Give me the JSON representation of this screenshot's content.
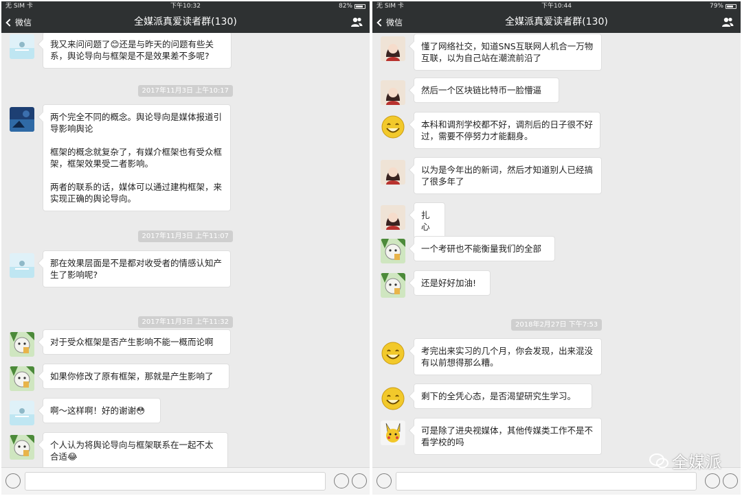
{
  "colors": {
    "navbar": "#2e3132",
    "chat_background": "#ebebeb",
    "bubble": "#ffffff",
    "time_pill": "#cfcfcf"
  },
  "left": {
    "status": {
      "carrier": "无 SIM 卡",
      "time": "下午10:32",
      "battery": "82%",
      "battery_level": 0.82
    },
    "nav": {
      "back_label": "微信",
      "title": "全媒派真爱读者群(130)"
    },
    "messages": [
      {
        "avatar": "beach-avatar",
        "text": "我又来问问题了😊还是与昨天的问题有些关系，舆论导向与框架是不是效果差不多呢?"
      },
      {
        "time": "2017年11月3日 上午10:17"
      },
      {
        "avatar": "dark-blue-avatar",
        "text": "两个完全不同的概念。舆论导向是媒体报道引导影响舆论\n\n框架的概念就复杂了，有媒介框架也有受众框架，框架效果受二者影响。\n\n两者的联系的话，媒体可以通过建构框架，来实现正确的舆论导向。"
      },
      {
        "time": "2017年11月3日 上午11:07"
      },
      {
        "avatar": "beach-avatar",
        "text": "那在效果层面是不是都对收受者的情感认知产生了影响呢?"
      },
      {
        "time": "2017年11月3日 上午11:32"
      },
      {
        "avatar": "cartoon-avatar",
        "text": "对于受众框架是否产生影响不能一概而论啊"
      },
      {
        "avatar": "cartoon-avatar",
        "text": "如果你修改了原有框架，那就是产生影响了"
      },
      {
        "avatar": "beach-avatar",
        "text": "啊～这样啊！好的谢谢😳"
      },
      {
        "avatar": "cartoon-avatar",
        "text": "个人认为将舆论导向与框架联系在一起不太合适😂"
      }
    ]
  },
  "right": {
    "status": {
      "carrier": "无 SIM 卡",
      "time": "下午10:44",
      "battery": "79%",
      "battery_level": 0.79
    },
    "nav": {
      "back_label": "微信",
      "title": "全媒派真爱读者群(130)"
    },
    "messages": [
      {
        "avatar": "girl-avatar",
        "text": "懂了网络社交，知道SNS互联网人机合一万物互联，以为自己站在潮流前沿了"
      },
      {
        "avatar": "girl-avatar",
        "text": "然后一个区块链比特币一脸懵逼"
      },
      {
        "avatar": "smiley-avatar",
        "text": "本科和调剂学校都不好，调剂后的日子很不好过，需要不停努力才能翻身。"
      },
      {
        "avatar": "girl-avatar",
        "text": "以为是今年出的新词，然后才知道别人已经搞了很多年了"
      },
      {
        "avatar": "girl-avatar",
        "text": "扎心"
      },
      {
        "avatar": "cartoon-avatar",
        "text": "一个考研也不能衡量我们的全部"
      },
      {
        "avatar": "cartoon-avatar",
        "text": "还是好好加油!"
      },
      {
        "time": "2018年2月27日 下午7:53"
      },
      {
        "avatar": "smiley-avatar",
        "text": "考完出来实习的几个月，你会发现，出来混没有以前想得那么糟。"
      },
      {
        "avatar": "smiley-avatar",
        "text": "剩下的全凭心态，是否渴望研究生学习。"
      },
      {
        "avatar": "pikachu-avatar",
        "text": "可是除了进央视媒体，其他传媒类工作不是不看学校的吗"
      }
    ]
  },
  "watermark": "全媒派"
}
